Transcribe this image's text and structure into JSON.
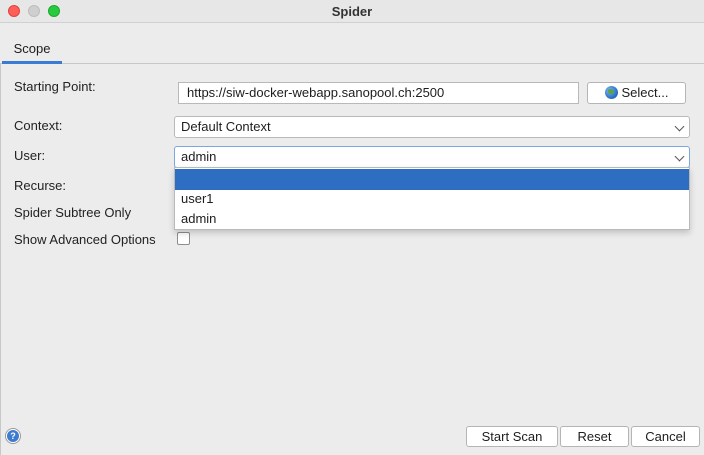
{
  "window": {
    "title": "Spider"
  },
  "tabs": [
    {
      "label": "Scope",
      "active": true
    }
  ],
  "form": {
    "starting_point": {
      "label": "Starting Point:",
      "value": "https://siw-docker-webapp.sanopool.ch:2500",
      "select_label": "Select..."
    },
    "context": {
      "label": "Context:",
      "value": "Default Context"
    },
    "user": {
      "label": "User:",
      "value": "admin",
      "options": [
        "",
        "user1",
        "admin"
      ],
      "highlighted_option": ""
    },
    "recurse": {
      "label": "Recurse:"
    },
    "spider_subtree_only": {
      "label": "Spider Subtree Only"
    },
    "show_advanced_options": {
      "label": "Show Advanced Options",
      "checked": false
    }
  },
  "buttons": {
    "start_scan": "Start Scan",
    "reset": "Reset",
    "cancel": "Cancel"
  },
  "help_icon": "?",
  "colors": {
    "selection": "#2d6dc2",
    "tab_indicator": "#3a7bd5"
  }
}
